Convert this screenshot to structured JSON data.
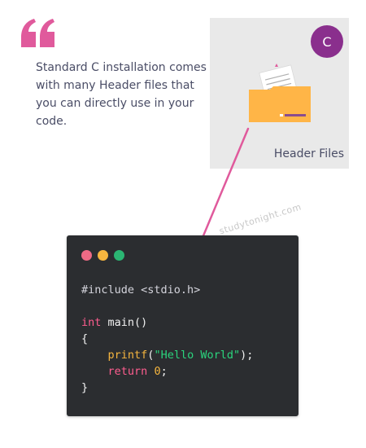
{
  "quote": {
    "text": "Standard C installation comes with many Header files that you can directly use in your code."
  },
  "header_box": {
    "badge_letter": "C",
    "caption": "Header Files",
    "folder_icon": "folder-icon"
  },
  "watermark": {
    "text": "studytonight.com"
  },
  "code_window": {
    "window_controls": [
      "close-dot",
      "minimize-dot",
      "maximize-dot"
    ],
    "line1": "#include <stdio.h>",
    "line2_keyword": "int",
    "line2_rest": " main()",
    "line3": "{",
    "line4_func": "printf",
    "line4_open": "(",
    "line4_string": "\"Hello World\"",
    "line4_close": ");",
    "line5_keyword": "return",
    "line5_space": " ",
    "line5_number": "0",
    "line5_semicolon": ";",
    "line6": "}"
  },
  "colors": {
    "accent_pink": "#e05a9c",
    "badge_purple": "#8a2f8d",
    "folder_orange": "#ffb547",
    "code_background": "#2b2d30"
  }
}
